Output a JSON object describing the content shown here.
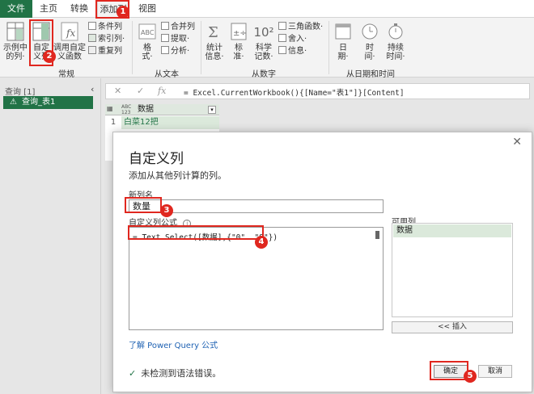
{
  "tabs": [
    "文件",
    "主页",
    "转换",
    "添加列",
    "视图"
  ],
  "ribbon": {
    "example_col": [
      "示例中",
      "的列·"
    ],
    "custom_col": [
      "自定",
      "义列"
    ],
    "invoke_fn": [
      "调用自定",
      "义函数"
    ],
    "cond_col": "条件列",
    "index_col": "索引列·",
    "dup_col": "重复列",
    "general_label": "常规",
    "format": [
      "格",
      "式·"
    ],
    "merge": "合并列",
    "extract": "提取·",
    "parse": "分析·",
    "from_text_label": "从文本",
    "stats": [
      "统计",
      "信息·"
    ],
    "standard": [
      "标",
      "准·"
    ],
    "sci": [
      "科学",
      "记数·"
    ],
    "trig": "三角函数·",
    "round": "舍入·",
    "info": "信息·",
    "from_number_label": "从数字",
    "date": [
      "日",
      "期·"
    ],
    "time": [
      "时",
      "间·"
    ],
    "duration": [
      "持续",
      "时间·"
    ],
    "from_datetime_label": "从日期和时间",
    "ten_sq": "10²"
  },
  "queries": {
    "header": "查询 [1]",
    "item": "查询_表1"
  },
  "formula_bar": {
    "text": "= Excel.CurrentWorkbook(){[Name=\"表1\"]}[Content]"
  },
  "grid": {
    "type_label": "ABC\n123",
    "column": "数据",
    "row_num": "1",
    "cell": "白菜12把"
  },
  "dialog": {
    "title": "自定义列",
    "subtitle": "添加从其他列计算的列。",
    "new_col_label": "新列名",
    "new_col_value": "数量",
    "formula_label": "自定义列公式",
    "formula": "= Text.Select([数据],{\"0\"..\"9\"})",
    "available_label": "可用列",
    "available_items": [
      "数据"
    ],
    "insert": "<< 插入",
    "learn": "了解 Power Query 公式",
    "status": "未检测到语法错误。",
    "ok": "确定",
    "cancel": "取消"
  },
  "badges": [
    "1",
    "2",
    "3",
    "4",
    "5"
  ]
}
